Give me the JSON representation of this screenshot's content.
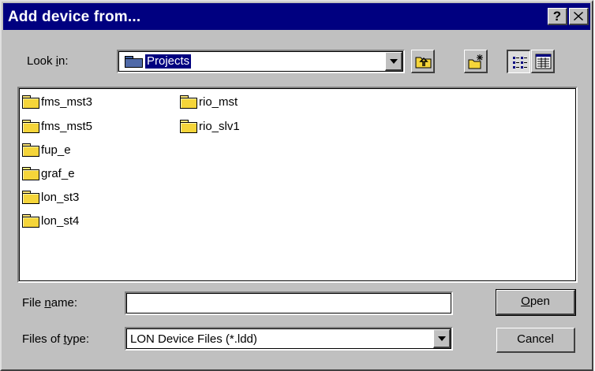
{
  "window": {
    "title": "Add device from...",
    "help_button": "?",
    "close_button": "✕"
  },
  "look_in": {
    "label_prefix": "Look ",
    "label_access_key": "i",
    "label_suffix": "n:",
    "value": "Projects"
  },
  "toolbar": {
    "up_one_level": "up-folder-icon",
    "create_new_folder": "new-folder-icon",
    "list_view": "list-view-icon",
    "details_view": "details-view-icon"
  },
  "files": [
    "fms_mst3",
    "fms_mst5",
    "fup_e",
    "graf_e",
    "lon_st3",
    "lon_st4",
    "rio_mst",
    "rio_slv1"
  ],
  "file_name": {
    "label_prefix": "File ",
    "label_access_key": "n",
    "label_suffix": "ame:",
    "value": ""
  },
  "file_type": {
    "label_prefix": "Files of ",
    "label_access_key": "t",
    "label_suffix": "ype:",
    "value": "LON Device Files (*.ldd)"
  },
  "buttons": {
    "open_access_key": "O",
    "open_rest": "pen",
    "cancel": "Cancel"
  },
  "colors": {
    "titlebar": "#000080",
    "face": "#c0c0c0",
    "selection": "#000080"
  }
}
